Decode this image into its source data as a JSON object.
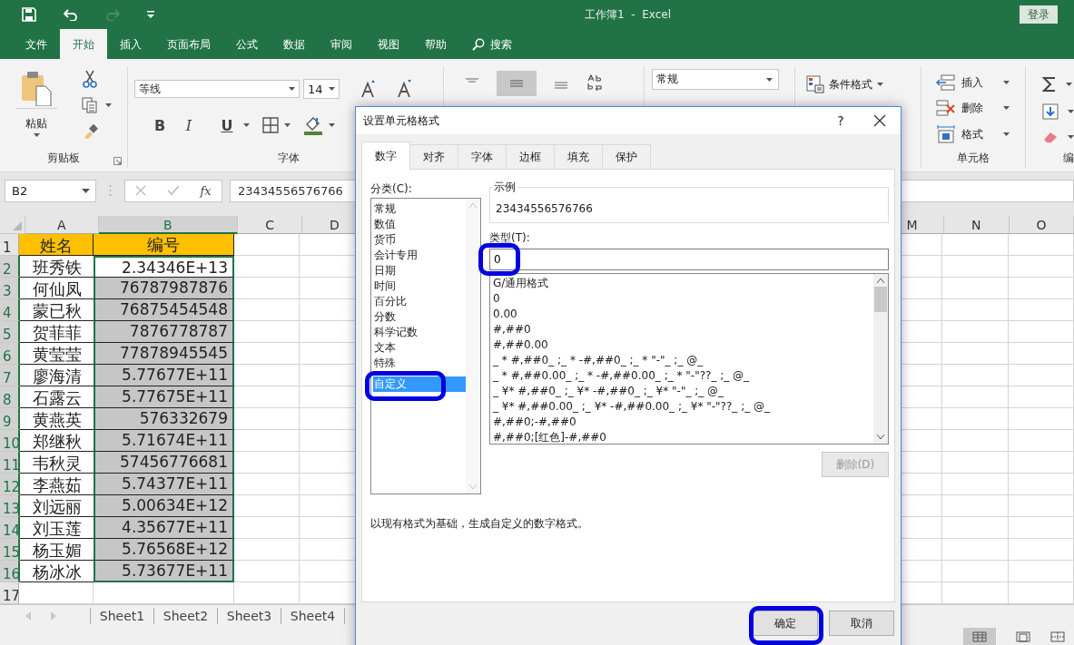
{
  "title_bar": {
    "title": "工作簿1  -  Excel",
    "sign_in": "登录"
  },
  "menu_tabs": [
    {
      "label": "文件",
      "selected": false
    },
    {
      "label": "开始",
      "selected": true
    },
    {
      "label": "插入",
      "selected": false
    },
    {
      "label": "页面布局",
      "selected": false
    },
    {
      "label": "公式",
      "selected": false
    },
    {
      "label": "数据",
      "selected": false
    },
    {
      "label": "审阅",
      "selected": false
    },
    {
      "label": "视图",
      "selected": false
    },
    {
      "label": "帮助",
      "selected": false
    },
    {
      "label": "搜索",
      "selected": false,
      "kind": "search"
    }
  ],
  "ribbon": {
    "clipboard": {
      "paste": "粘贴",
      "label": "剪贴板"
    },
    "font": {
      "font_name": "等线",
      "font_size": "14",
      "bold": "B",
      "italic": "I",
      "underline": "U",
      "label": "字体"
    },
    "number": {
      "format": "常规"
    },
    "styles": {
      "conditional": "条件格式"
    },
    "cells": {
      "insert": "插入",
      "delete": "删除",
      "format": "格式",
      "label": "单元格"
    },
    "editing": {
      "label": "编"
    }
  },
  "formula_bar": {
    "name_box": "B2",
    "fx": "fx",
    "value": "23434556576766"
  },
  "sheet": {
    "columns_left": [
      {
        "label": "A",
        "selected": false
      },
      {
        "label": "B",
        "selected": true
      },
      {
        "label": "C",
        "selected": false
      },
      {
        "label": "D",
        "selected": false
      }
    ],
    "columns_right": [
      {
        "label": "M",
        "selected": false
      },
      {
        "label": "N",
        "selected": false
      },
      {
        "label": "O",
        "selected": false
      }
    ],
    "rows": [
      {
        "number": "1",
        "kind": "header",
        "name": "姓名",
        "id": "编号",
        "selected": false,
        "active": false
      },
      {
        "number": "2",
        "name": "班秀铁",
        "id": "2.34346E+13",
        "selected": true,
        "active": true
      },
      {
        "number": "3",
        "name": "何仙凤",
        "id": "76787987876",
        "selected": true,
        "active": false
      },
      {
        "number": "4",
        "name": "蒙已秋",
        "id": "76875454548",
        "selected": true,
        "active": false
      },
      {
        "number": "5",
        "name": "贺菲菲",
        "id": "7876778787",
        "selected": true,
        "active": false
      },
      {
        "number": "6",
        "name": "黄莹莹",
        "id": "77878945545",
        "selected": true,
        "active": false
      },
      {
        "number": "7",
        "name": "廖海清",
        "id": "5.77677E+11",
        "selected": true,
        "active": false
      },
      {
        "number": "8",
        "name": "石露云",
        "id": "5.77675E+11",
        "selected": true,
        "active": false
      },
      {
        "number": "9",
        "name": "黄燕英",
        "id": "576332679",
        "selected": true,
        "active": false
      },
      {
        "number": "10",
        "name": "郑继秋",
        "id": "5.71674E+11",
        "selected": true,
        "active": false
      },
      {
        "number": "11",
        "name": "韦秋灵",
        "id": "57456776681",
        "selected": true,
        "active": false
      },
      {
        "number": "12",
        "name": "李燕茹",
        "id": "5.74377E+11",
        "selected": true,
        "active": false
      },
      {
        "number": "13",
        "name": "刘远丽",
        "id": "5.00634E+12",
        "selected": true,
        "active": false
      },
      {
        "number": "14",
        "name": "刘玉莲",
        "id": "4.35677E+11",
        "selected": true,
        "active": false
      },
      {
        "number": "15",
        "name": "杨玉媚",
        "id": "5.76568E+12",
        "selected": true,
        "active": false
      },
      {
        "number": "16",
        "name": "杨冰冰",
        "id": "5.73677E+11",
        "selected": true,
        "active": false
      },
      {
        "number": "17",
        "selected": false,
        "active": false
      }
    ]
  },
  "sheet_tabs": [
    {
      "label": "Sheet1",
      "selected": false
    },
    {
      "label": "Sheet2",
      "selected": false
    },
    {
      "label": "Sheet3",
      "selected": false
    },
    {
      "label": "Sheet4",
      "selected": false
    }
  ],
  "dialog": {
    "title": "设置单元格格式",
    "help": "?",
    "tabs": [
      {
        "label": "数字",
        "selected": true
      },
      {
        "label": "对齐",
        "selected": false
      },
      {
        "label": "字体",
        "selected": false
      },
      {
        "label": "边框",
        "selected": false
      },
      {
        "label": "填充",
        "selected": false
      },
      {
        "label": "保护",
        "selected": false
      }
    ],
    "category_label": "分类(C):",
    "categories": [
      {
        "label": "常规",
        "selected": false,
        "highlighted": false
      },
      {
        "label": "数值",
        "selected": false,
        "highlighted": false
      },
      {
        "label": "货币",
        "selected": false,
        "highlighted": false
      },
      {
        "label": "会计专用",
        "selected": false,
        "highlighted": false
      },
      {
        "label": "日期",
        "selected": false,
        "highlighted": false
      },
      {
        "label": "时间",
        "selected": false,
        "highlighted": false
      },
      {
        "label": "百分比",
        "selected": false,
        "highlighted": false
      },
      {
        "label": "分数",
        "selected": false,
        "highlighted": false
      },
      {
        "label": "科学记数",
        "selected": false,
        "highlighted": false
      },
      {
        "label": "文本",
        "selected": false,
        "highlighted": false
      },
      {
        "label": "特殊",
        "selected": false,
        "highlighted": false
      },
      {
        "label": "自定义",
        "selected": true,
        "highlighted": true
      }
    ],
    "sample_label": "示例",
    "sample_value": "23434556576766",
    "type_label": "类型(T):",
    "type_value": "0",
    "type_highlighted": true,
    "formats": [
      "G/通用格式",
      "0",
      "0.00",
      "#,##0",
      "#,##0.00",
      "_ * #,##0_ ;_ * -#,##0_ ;_ * \"-\"_ ;_ @_",
      "_ * #,##0.00_ ;_ * -#,##0.00_ ;_ * \"-\"??_ ;_ @_",
      "_ ¥* #,##0_ ;_ ¥* -#,##0_ ;_ ¥* \"-\"_ ;_ @_",
      "_ ¥* #,##0.00_ ;_ ¥* -#,##0.00_ ;_ ¥* \"-\"??_ ;_ @_",
      "#,##0;-#,##0",
      "#,##0;[红色]-#,##0"
    ],
    "delete_button": {
      "label": "删除(D)",
      "disabled": true
    },
    "description": "以现有格式为基础，生成自定义的数字格式。",
    "buttons": [
      {
        "label": "确定",
        "highlighted": true
      },
      {
        "label": "取消",
        "highlighted": false
      }
    ]
  }
}
